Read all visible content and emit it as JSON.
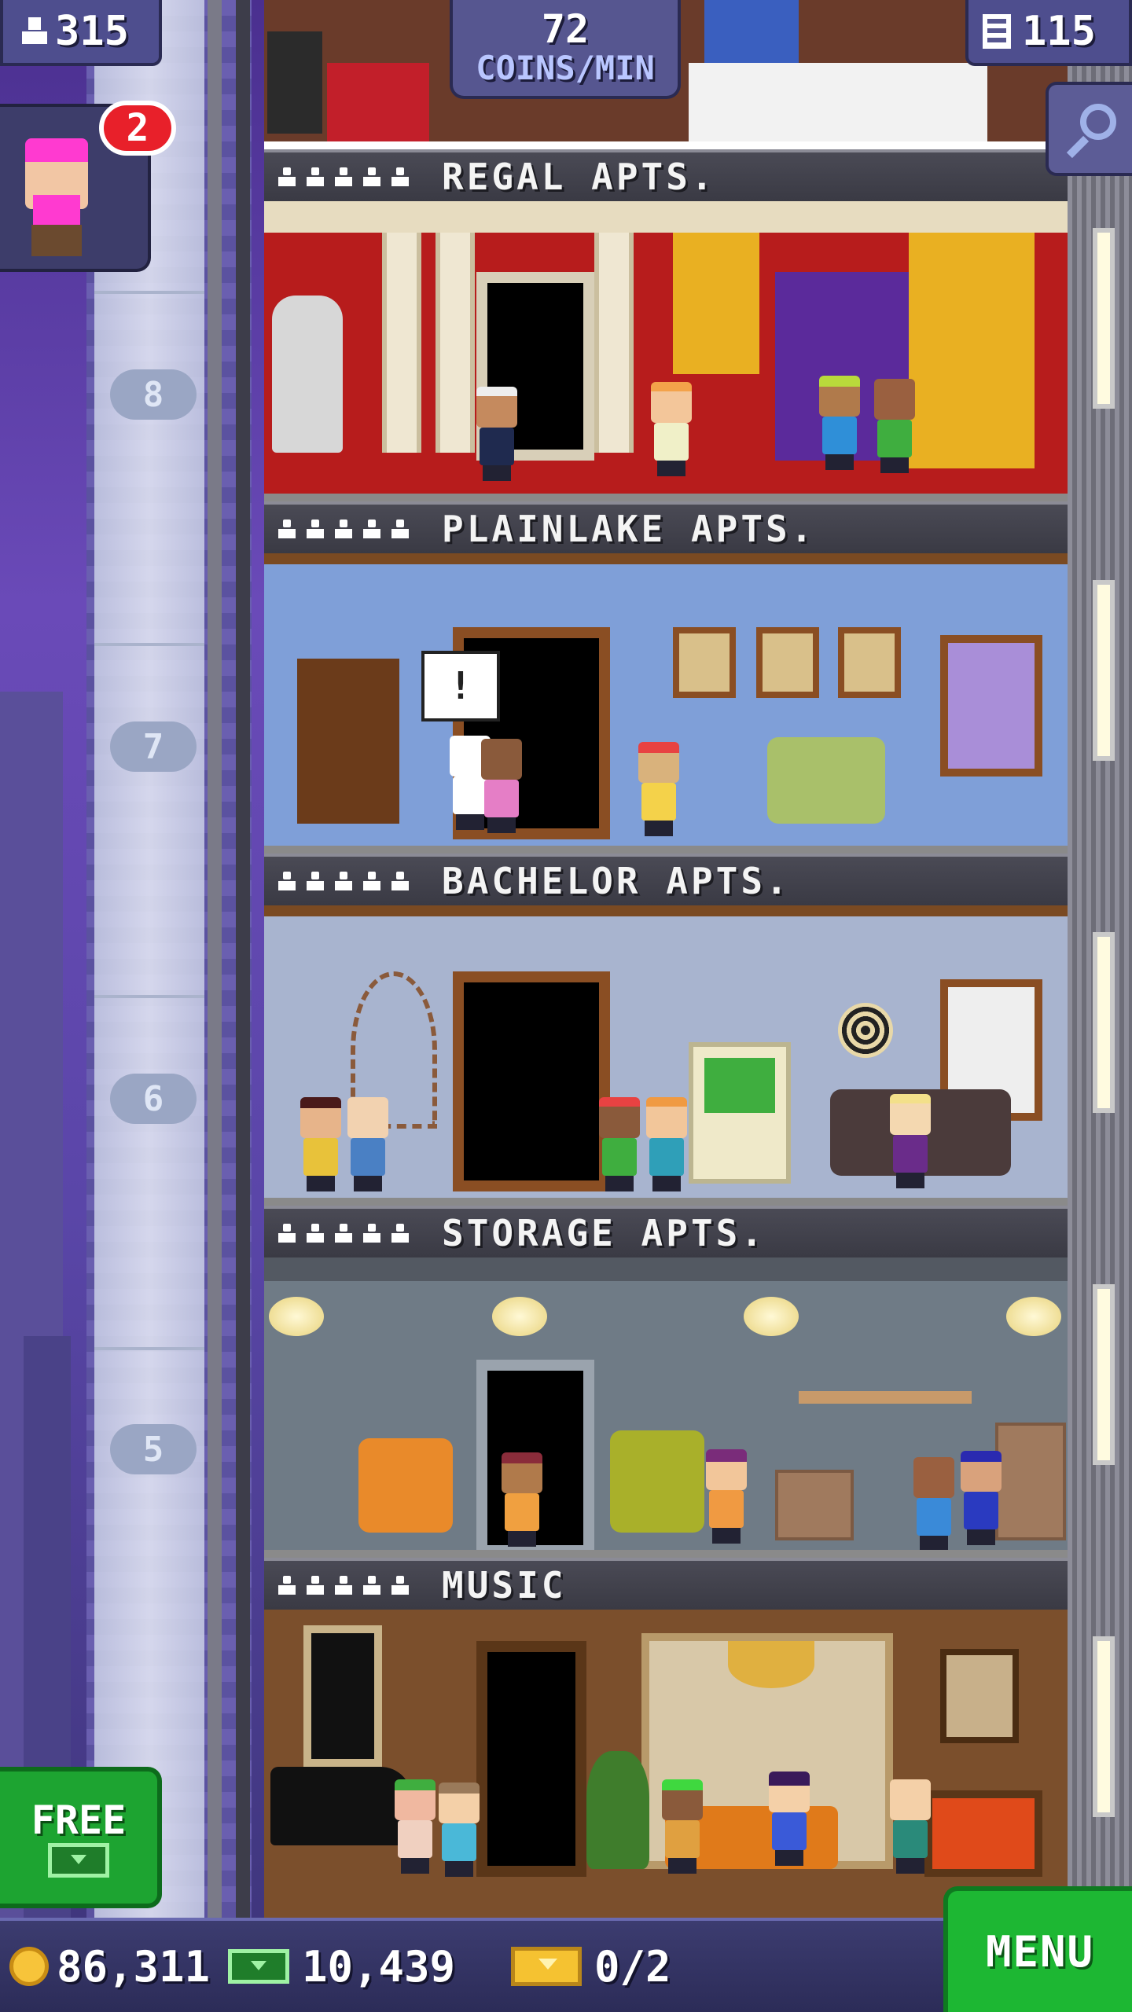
{
  "hud": {
    "population": "315",
    "coins_per_min_value": "72",
    "coins_per_min_label": "COINS/MIN",
    "floor_count": "115",
    "visitor_badge_count": "2"
  },
  "elevator": {
    "floor_numbers": [
      "8",
      "7",
      "6",
      "5"
    ]
  },
  "floors": [
    {
      "name": "REGAL APTS.",
      "residents_filled": 5
    },
    {
      "name": "PLAINLAKE APTS.",
      "residents_filled": 5
    },
    {
      "name": "BACHELOR APTS.",
      "residents_filled": 5
    },
    {
      "name": "STORAGE APTS.",
      "residents_filled": 5
    },
    {
      "name": "MUSIC",
      "residents_filled": 5
    }
  ],
  "speech_bubble": "!",
  "free_button": {
    "label": "FREE"
  },
  "bottom": {
    "coins": "86,311",
    "bux": "10,439",
    "golden_tickets": "0/2",
    "menu_label": "MENU"
  },
  "colors": {
    "hud_panel": "#4e4e8e",
    "free_green": "#1da431",
    "menu_green": "#1db733",
    "badge_red": "#e8202a",
    "coin_gold": "#f7c43a"
  },
  "icons": {
    "population": "person-icon",
    "floors": "building-icon",
    "search": "magnifier-icon",
    "coins": "coin-icon",
    "bux": "bux-icon",
    "tickets": "golden-ticket-icon"
  }
}
